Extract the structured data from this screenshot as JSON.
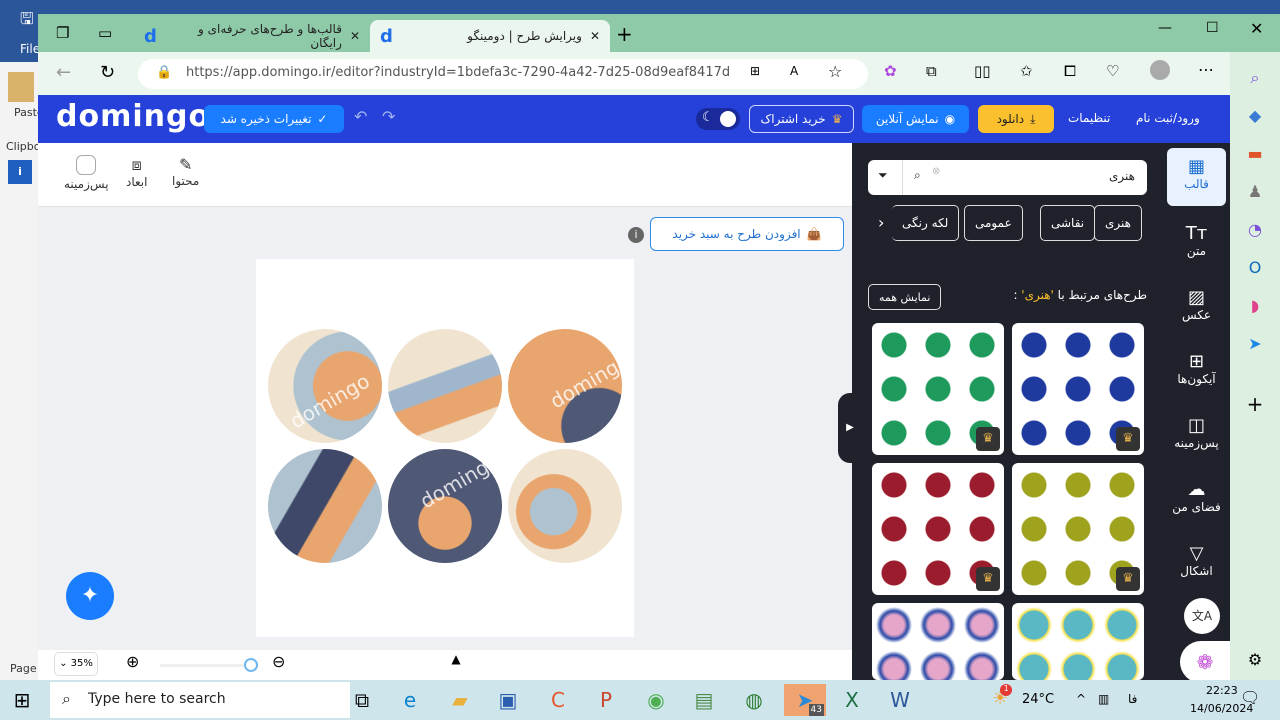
{
  "word": {
    "file_label": "File",
    "paste_label": "Paste",
    "clipboard_label": "Clipbo",
    "page_label": "Page"
  },
  "browser": {
    "tabs": [
      {
        "title": "قالب‌ها و طرح‌های حرفه‌ای و رایگان",
        "active": false
      },
      {
        "title": "ویرایش طرح | دومینگو",
        "active": true
      }
    ],
    "url": "https://app.domingo.ir/editor?industryId=1bdefa3c-7290-4a42-7d25-08d9eaf8417d"
  },
  "header": {
    "logo": "domingo",
    "saved": "تغییرات ذخیره شد",
    "subscribe": "خرید اشتراک",
    "preview": "نمایش آنلاین",
    "download": "دانلود",
    "settings": "تنظیمات",
    "login": "ورود/ثبت نام",
    "brand_color": "#2541d9",
    "download_color": "#fbc02d"
  },
  "toolbar": {
    "content": "محتوا",
    "dimensions": "ابعاد",
    "background": "پس‌زمینه"
  },
  "canvas": {
    "add_to_cart": "افزودن طرح به سبد خرید",
    "watermark": "domingo",
    "zoom": "35%"
  },
  "panel": {
    "search_value": "هنری",
    "chips": [
      "هنری",
      "نقاشی",
      "عمومی",
      "لکه رنگی"
    ],
    "related_prefix": "طرح‌های مرتبط با ",
    "related_term": "'هنری'",
    "related_suffix": " :",
    "show_all": "نمایش همه",
    "templates": [
      {
        "color": "#1f3a9e"
      },
      {
        "color": "#1e9a5c"
      },
      {
        "color": "#9ea21d"
      },
      {
        "color": "#9b1c2c"
      },
      {
        "color": "#5ab8c4"
      },
      {
        "color": "#e6a6c9"
      }
    ]
  },
  "rail": [
    {
      "label": "قالب",
      "icon": "template-icon"
    },
    {
      "label": "متن",
      "icon": "text-icon"
    },
    {
      "label": "عکس",
      "icon": "image-icon"
    },
    {
      "label": "آیکون‌ها",
      "icon": "grid-icon"
    },
    {
      "label": "پس‌زمینه",
      "icon": "background-icon"
    },
    {
      "label": "فضای من",
      "icon": "cloud-upload-icon"
    },
    {
      "label": "اشکال",
      "icon": "shapes-icon"
    }
  ],
  "taskbar": {
    "search_placeholder": "Type here to search",
    "weather": "24°C",
    "lang": "فا",
    "time": "22:23",
    "date": "14/06/2024",
    "telegram_badge": "43",
    "weather_badge": "1"
  }
}
